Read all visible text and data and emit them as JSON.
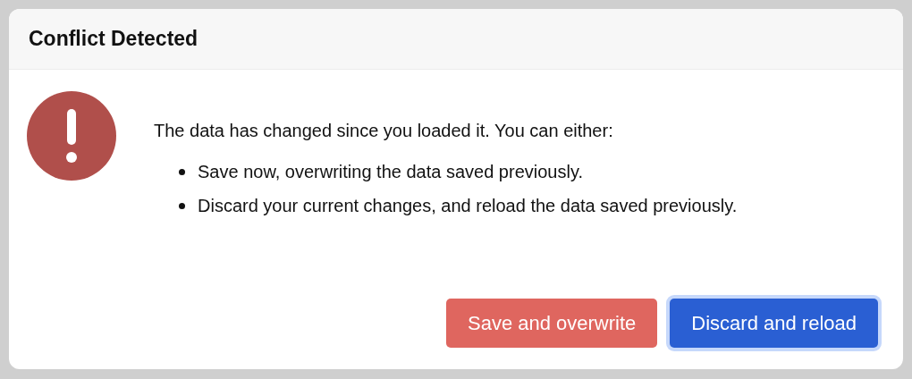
{
  "dialog": {
    "title": "Conflict Detected",
    "message": "The data has changed since you loaded it. You can either:",
    "options": [
      "Save now, overwriting the data saved previously.",
      "Discard your current changes, and reload the data saved previously."
    ],
    "buttons": [
      {
        "label": "Save and overwrite",
        "kind": "danger",
        "focused": false
      },
      {
        "label": "Discard and reload",
        "kind": "primary",
        "focused": true
      }
    ]
  }
}
